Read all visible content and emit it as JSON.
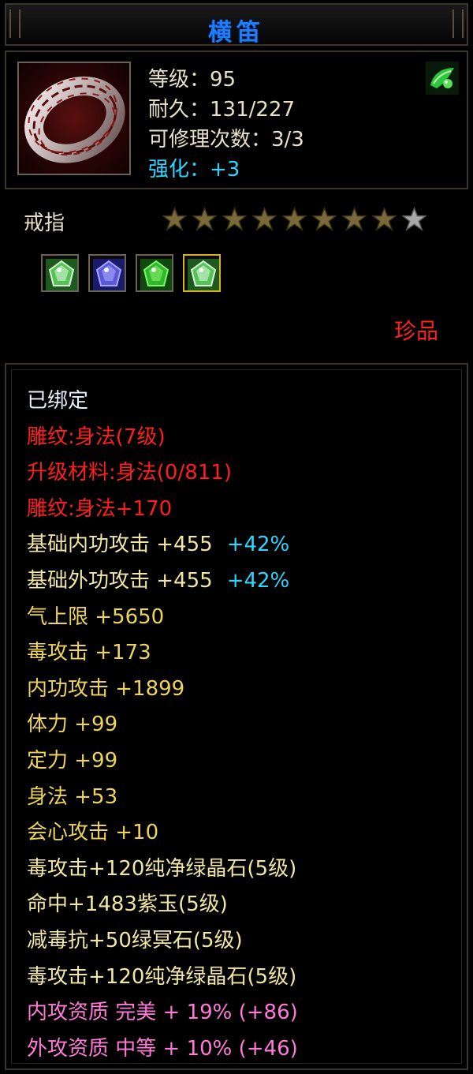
{
  "title": "横笛",
  "header": {
    "level": "等级：95",
    "durability": "耐久：131/227",
    "repair_times": "可修理次数：3/3",
    "enhance": "强化：+3",
    "corner_icon": "green-gem-icon"
  },
  "item": {
    "type": "戒指",
    "stars_total": 9,
    "stars_filled": 8,
    "rarity": "珍品",
    "sockets": [
      {
        "icon": "white-green-crystal-icon",
        "selected": false
      },
      {
        "icon": "purple-crystal-icon",
        "selected": false
      },
      {
        "icon": "green-crystal-icon",
        "selected": false
      },
      {
        "icon": "white-green-crystal-icon",
        "selected": true
      }
    ]
  },
  "attributes": [
    {
      "text": "已绑定",
      "color": "white"
    },
    {
      "text": "雕纹:身法(7级)",
      "color": "red"
    },
    {
      "text": "升级材料:身法(0/811)",
      "color": "red"
    },
    {
      "text": "雕纹:身法+170",
      "color": "red"
    },
    {
      "text": "基础内功攻击 +455",
      "extra": "+42%",
      "color": "gold"
    },
    {
      "text": "基础外功攻击 +455",
      "extra": "+42%",
      "color": "gold"
    },
    {
      "text": "气上限 +5650",
      "color": "yellow"
    },
    {
      "text": "毒攻击 +173",
      "color": "yellow"
    },
    {
      "text": "内功攻击 +1899",
      "color": "yellow"
    },
    {
      "text": "体力 +99",
      "color": "yellow"
    },
    {
      "text": "定力 +99",
      "color": "yellow"
    },
    {
      "text": "身法 +53",
      "color": "yellow"
    },
    {
      "text": "会心攻击 +10",
      "color": "yellow"
    },
    {
      "text": "毒攻击+120纯净绿晶石(5级)",
      "color": "gold"
    },
    {
      "text": "命中+1483紫玉(5级)",
      "color": "gold"
    },
    {
      "text": "减毒抗+50绿冥石(5级)",
      "color": "gold"
    },
    {
      "text": "毒攻击+120纯净绿晶石(5级)",
      "color": "gold"
    },
    {
      "text": "内攻资质 完美 + 19% (+86)",
      "color": "pink"
    },
    {
      "text": "外攻资质 中等 + 10% (+46)",
      "color": "pink"
    }
  ]
}
